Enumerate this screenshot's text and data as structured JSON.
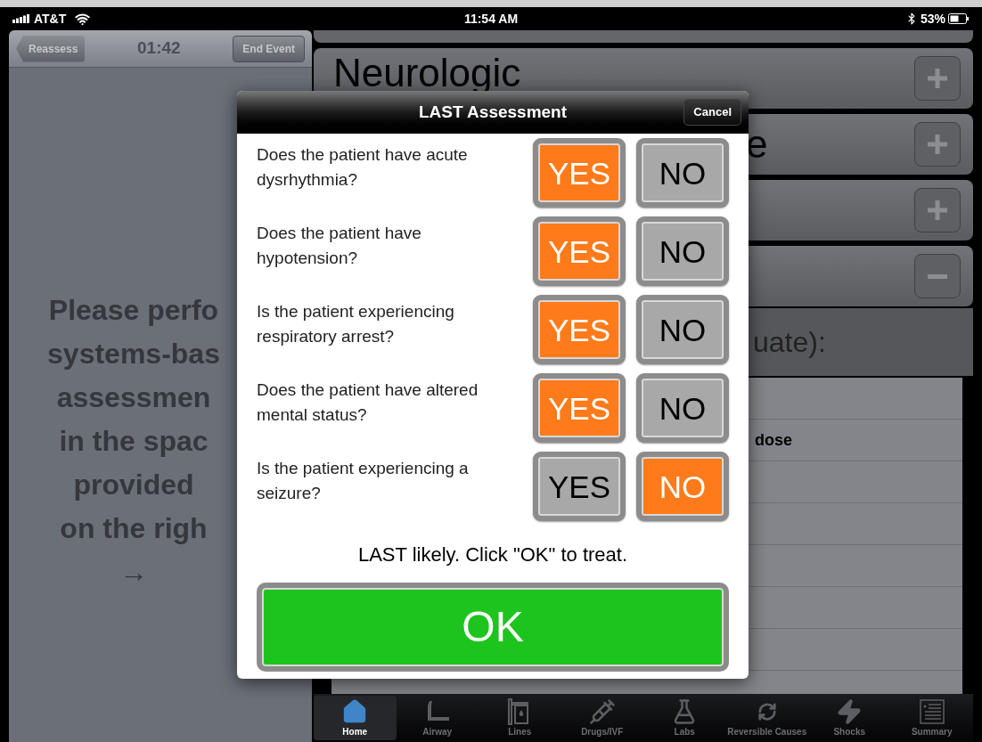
{
  "status_bar": {
    "carrier": "AT&T",
    "time": "11:54 AM",
    "battery": "53%"
  },
  "nav": {
    "back": "Reassess",
    "timer": "01:42",
    "end": "End Event"
  },
  "instructions": [
    "Please perfo",
    "systems-bas",
    "assessmen",
    "in the spac",
    "provided",
    "on the righ",
    "→"
  ],
  "systems": [
    {
      "label": "Neurologic",
      "expanded": false
    },
    {
      "label": "e",
      "expanded": false
    },
    {
      "expanded": false
    },
    {
      "expanded": true
    }
  ],
  "section_header": "uate):",
  "list_items": [
    {
      "text": "dose"
    }
  ],
  "tabs": [
    {
      "label": "Home",
      "kind": "home",
      "selected": true
    },
    {
      "label": "Airway",
      "kind": "airway",
      "selected": false
    },
    {
      "label": "Lines",
      "kind": "lines",
      "selected": false
    },
    {
      "label": "Drugs/IVF",
      "kind": "syringe",
      "selected": false
    },
    {
      "label": "Labs",
      "kind": "flask",
      "selected": false
    },
    {
      "label": "Reversible Causes",
      "kind": "cycle",
      "selected": false
    },
    {
      "label": "Shocks",
      "kind": "bolt",
      "selected": false
    },
    {
      "label": "Summary",
      "kind": "document",
      "selected": false
    }
  ],
  "dialog": {
    "title": "LAST Assessment",
    "cancel": "Cancel",
    "questions": [
      {
        "text": "Does the patient have acute dysrhythmia?",
        "yes": {
          "label": "YES",
          "selected": true
        },
        "no": {
          "label": "NO",
          "selected": false
        }
      },
      {
        "text": "Does the patient have hypotension?",
        "yes": {
          "label": "YES",
          "selected": true
        },
        "no": {
          "label": "NO",
          "selected": false
        }
      },
      {
        "text": "Is the patient experiencing respiratory arrest?",
        "yes": {
          "label": "YES",
          "selected": true
        },
        "no": {
          "label": "NO",
          "selected": false
        }
      },
      {
        "text": "Does the patient have altered mental status?",
        "yes": {
          "label": "YES",
          "selected": true
        },
        "no": {
          "label": "NO",
          "selected": false
        }
      },
      {
        "text": "Is the patient experiencing a seizure?",
        "yes": {
          "label": "YES",
          "selected": false
        },
        "no": {
          "label": "NO",
          "selected": true
        }
      }
    ],
    "message": "LAST likely. Click \"OK\" to treat.",
    "ok": "OK"
  }
}
